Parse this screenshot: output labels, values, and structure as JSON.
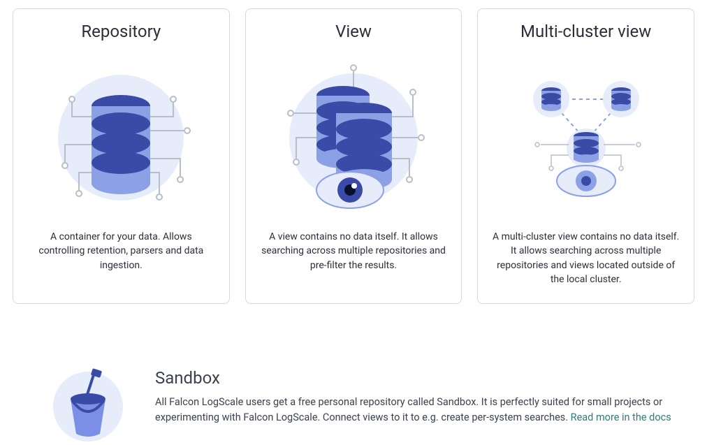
{
  "cards": [
    {
      "title": "Repository",
      "description": "A container for your data. Allows controlling retention, parsers and data ingestion."
    },
    {
      "title": "View",
      "description": "A view contains no data itself. It allows searching across multiple repositories and pre-filter the results."
    },
    {
      "title": "Multi-cluster view",
      "description": "A multi-cluster view contains no data itself. It allows searching across multiple repositories and views located outside of the local cluster."
    }
  ],
  "sandbox": {
    "title": "Sandbox",
    "description": "All Falcon LogScale users get a free personal repository called Sandbox. It is perfectly suited for small projects or experimenting with Falcon LogScale. Connect views to it to e.g. create per-system searches. ",
    "linkText": "Read more in the docs"
  },
  "colors": {
    "circleBg": "#E6ECFA",
    "dbDark": "#3A4BA7",
    "dbLight": "#8CA0E6",
    "lineGray": "#B7BECA",
    "iris": "#3A4BA7",
    "bucket": "#7C8FE6",
    "bucketDark": "#3A4BA7",
    "sandboxBg": "#E6ECFA"
  }
}
